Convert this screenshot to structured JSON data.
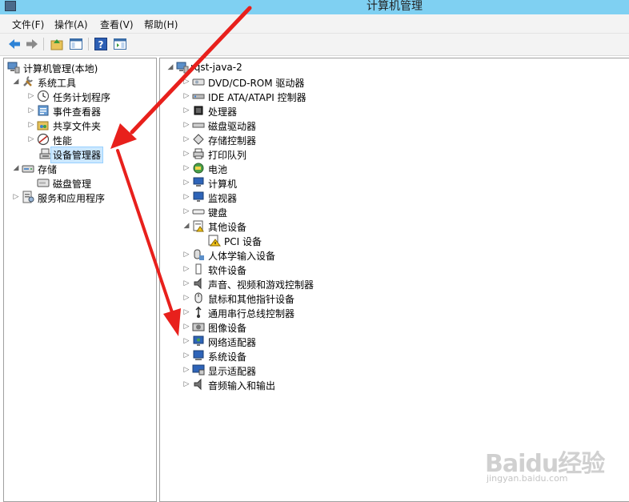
{
  "window": {
    "title": "计算机管理"
  },
  "menu": [
    "文件(F)",
    "操作(A)",
    "查看(V)",
    "帮助(H)"
  ],
  "toolbar": {
    "buttons": [
      "back-icon",
      "forward-icon",
      "up-folder-icon",
      "show-tree-icon",
      "help-icon",
      "action-pane-icon"
    ]
  },
  "left_tree": {
    "root": "计算机管理(本地)",
    "system_tools": "系统工具",
    "task_scheduler": "任务计划程序",
    "event_viewer": "事件查看器",
    "shared_folders": "共享文件夹",
    "performance": "性能",
    "device_manager": "设备管理器",
    "storage": "存储",
    "disk_management": "磁盘管理",
    "services_apps": "服务和应用程序"
  },
  "device_tree": {
    "computer": "rqst-java-2",
    "categories": [
      "DVD/CD-ROM 驱动器",
      "IDE ATA/ATAPI 控制器",
      "处理器",
      "磁盘驱动器",
      "存储控制器",
      "打印队列",
      "电池",
      "计算机",
      "监视器",
      "键盘",
      "其他设备",
      "PCI 设备",
      "人体学输入设备",
      "软件设备",
      "声音、视频和游戏控制器",
      "鼠标和其他指针设备",
      "通用串行总线控制器",
      "图像设备",
      "网络适配器",
      "系统设备",
      "显示适配器",
      "音频输入和输出"
    ]
  },
  "watermark": {
    "brand": "Baidu经验",
    "url": "jingyan.baidu.com"
  },
  "colors": {
    "titlebar": "#7fd0f2",
    "arrow": "#e8201c",
    "selection": "#cce8ff",
    "warning": "#f3c318"
  }
}
